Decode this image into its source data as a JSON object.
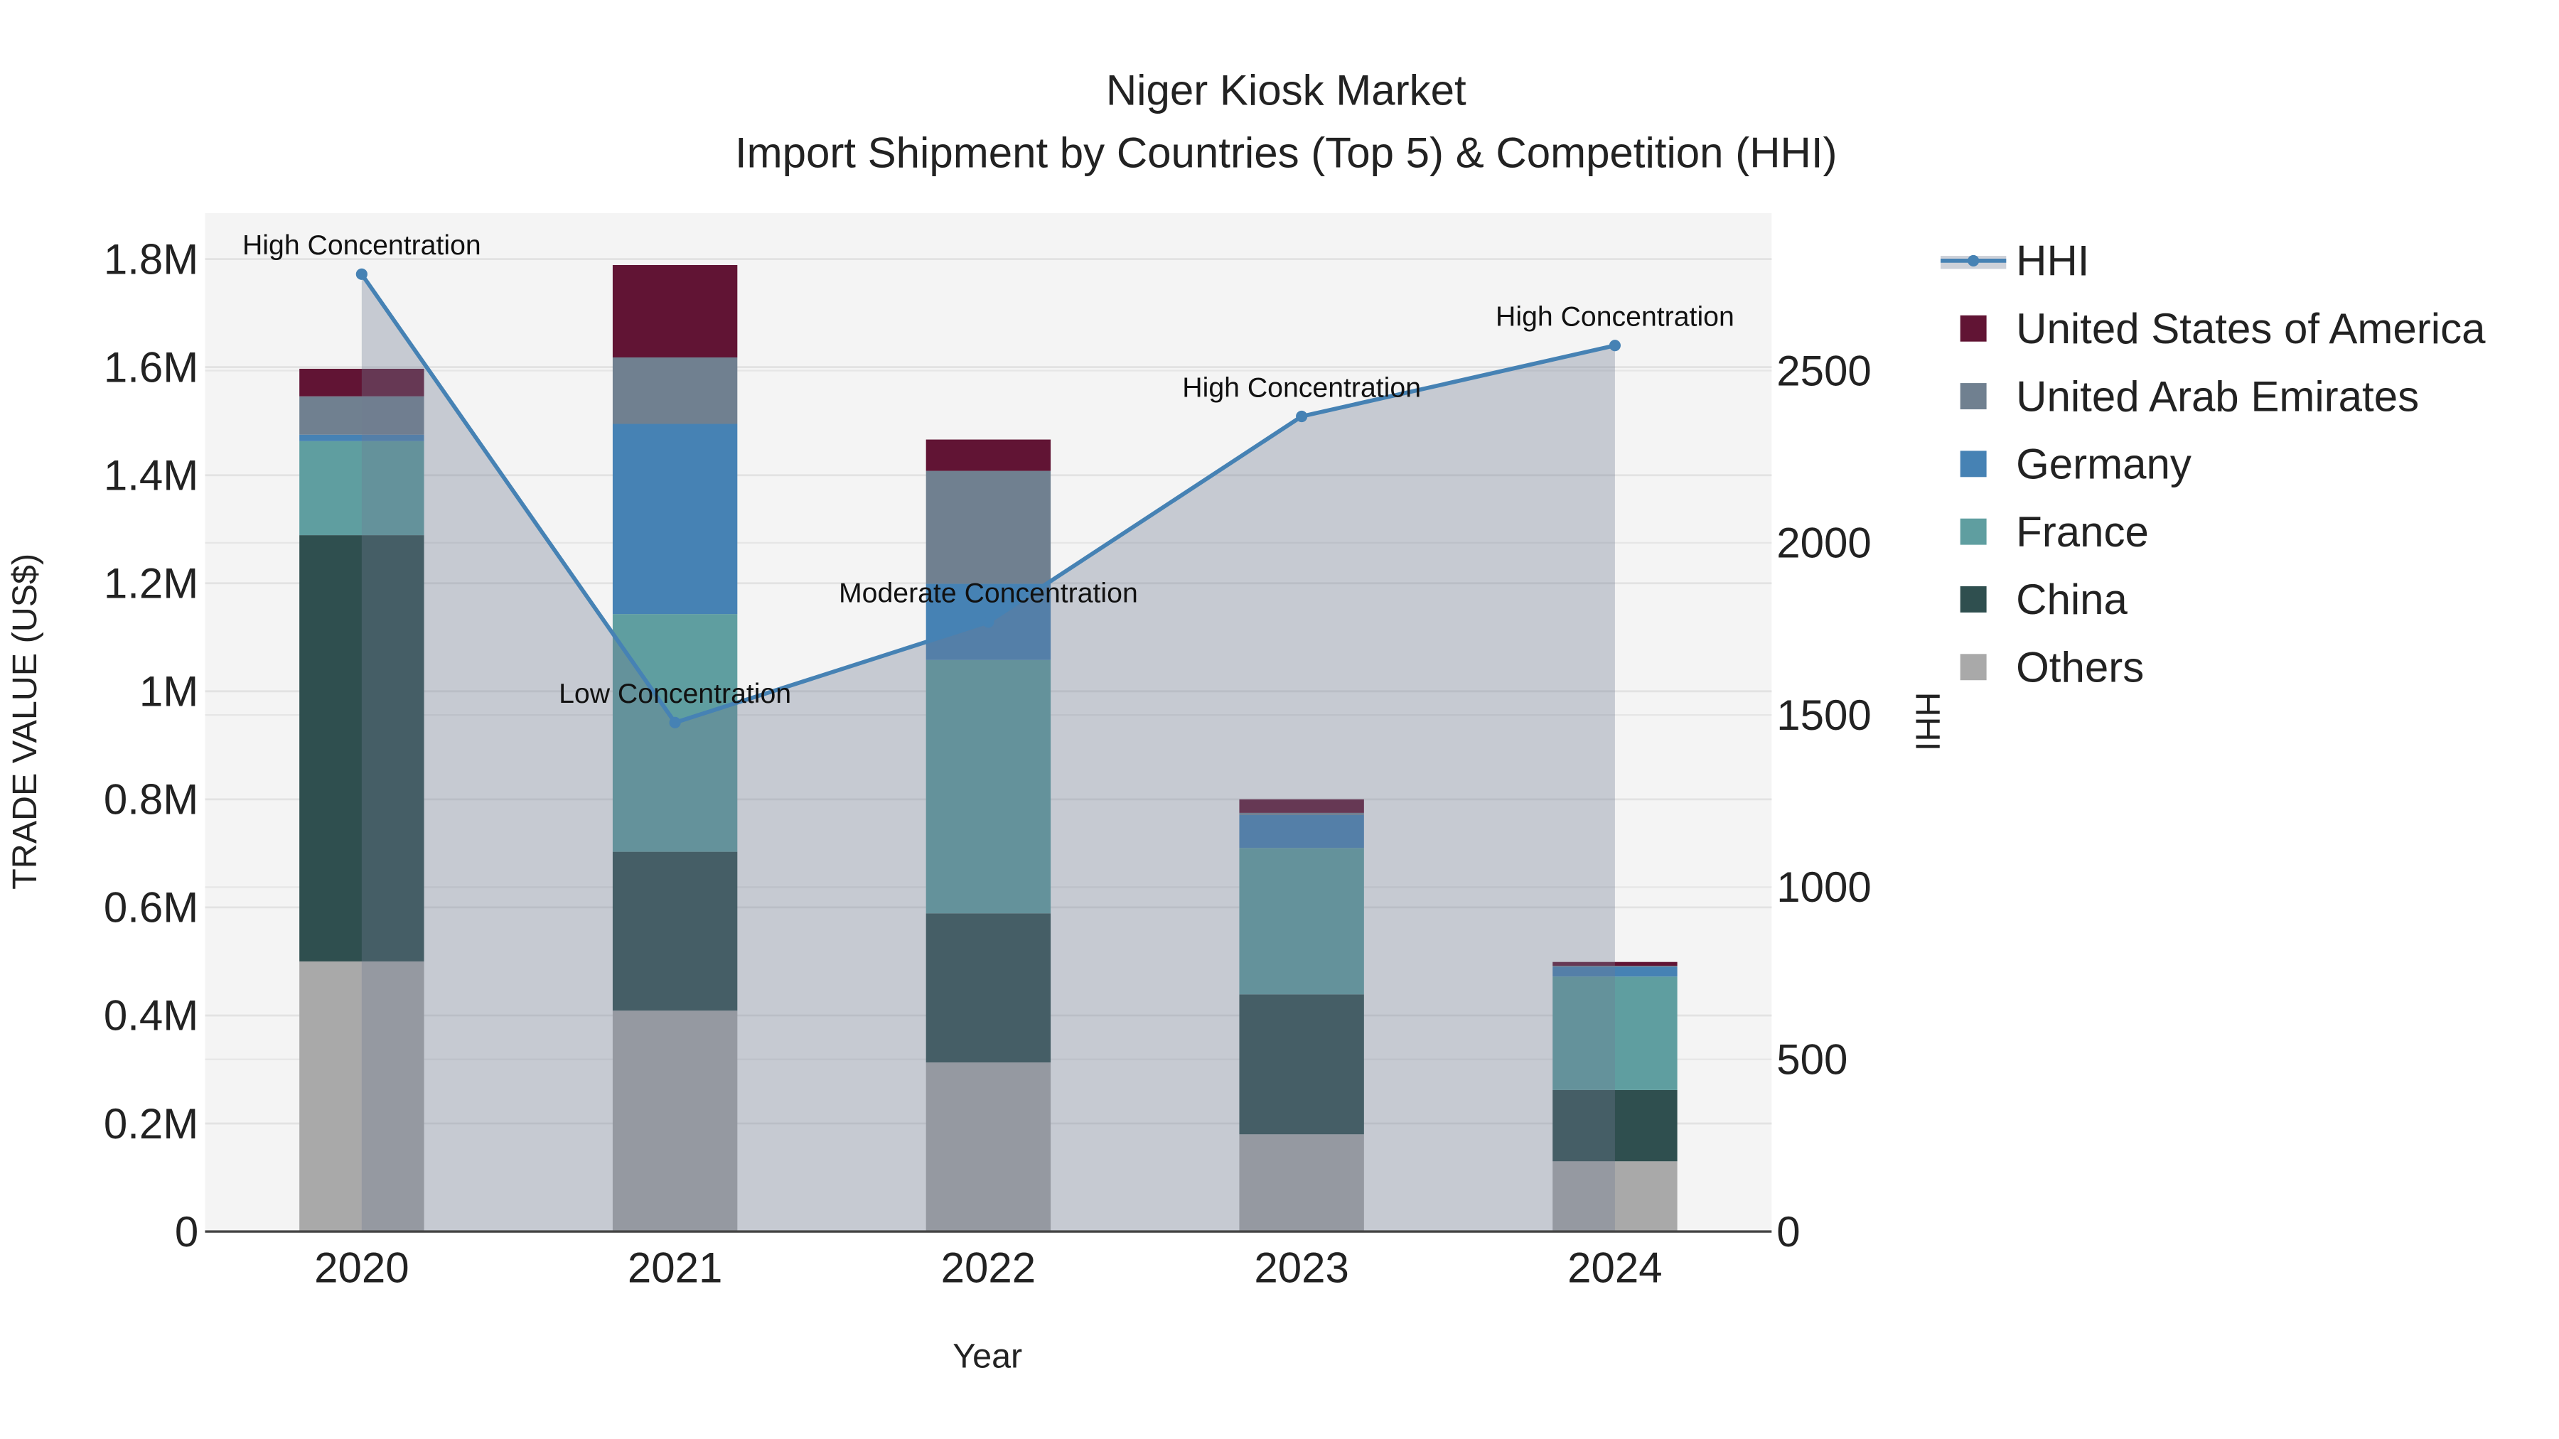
{
  "chart_data": {
    "type": "bar",
    "title": "Niger Kiosk Market",
    "subtitle": "Import Shipment by Countries (Top 5) & Competition (HHI)",
    "xlabel": "Year",
    "ylabel": "TRADE VALUE (US$)",
    "y2label": "HHI",
    "categories": [
      "2020",
      "2021",
      "2022",
      "2023",
      "2024"
    ],
    "ylim": [
      0,
      1880000
    ],
    "y2lim": [
      0,
      2900
    ],
    "yticks": [
      0,
      200000,
      400000,
      600000,
      800000,
      1000000,
      1200000,
      1400000,
      1600000,
      1800000
    ],
    "ytick_labels": [
      "0",
      "0.2M",
      "0.4M",
      "0.6M",
      "0.8M",
      "1M",
      "1.2M",
      "1.4M",
      "1.6M",
      "1.8M"
    ],
    "y2ticks": [
      0,
      500,
      1000,
      1500,
      2000,
      2500
    ],
    "y2tick_labels": [
      "0",
      "500",
      "1000",
      "1500",
      "2000",
      "2500"
    ],
    "grid": true,
    "legend_position": "right",
    "series": [
      {
        "name": "Others",
        "color": "#a9a9a9",
        "values": [
          500000,
          409000,
          313000,
          180000,
          130000
        ]
      },
      {
        "name": "China",
        "color": "#2f4f4f",
        "values": [
          789000,
          294000,
          276000,
          259000,
          132000
        ]
      },
      {
        "name": "France",
        "color": "#5f9ea0",
        "values": [
          174000,
          440000,
          469000,
          271000,
          210000
        ]
      },
      {
        "name": "Germany",
        "color": "#4682b4",
        "values": [
          12000,
          352000,
          141000,
          61000,
          18000
        ]
      },
      {
        "name": "United Arab Emirates",
        "color": "#708090",
        "values": [
          71000,
          123000,
          209000,
          4000,
          2000
        ]
      },
      {
        "name": "United States of America",
        "color": "#611434",
        "values": [
          51000,
          171000,
          58000,
          25000,
          7000
        ]
      }
    ],
    "hhi": {
      "name": "HHI",
      "color": "#4682b4",
      "values": [
        2780,
        1478,
        1770,
        2367,
        2573
      ],
      "annotations": [
        "High Concentration",
        "Low Concentration",
        "Moderate Concentration",
        "High Concentration",
        "High Concentration"
      ]
    },
    "legend_order": [
      "HHI",
      "United States of America",
      "United Arab Emirates",
      "Germany",
      "France",
      "China",
      "Others"
    ]
  }
}
